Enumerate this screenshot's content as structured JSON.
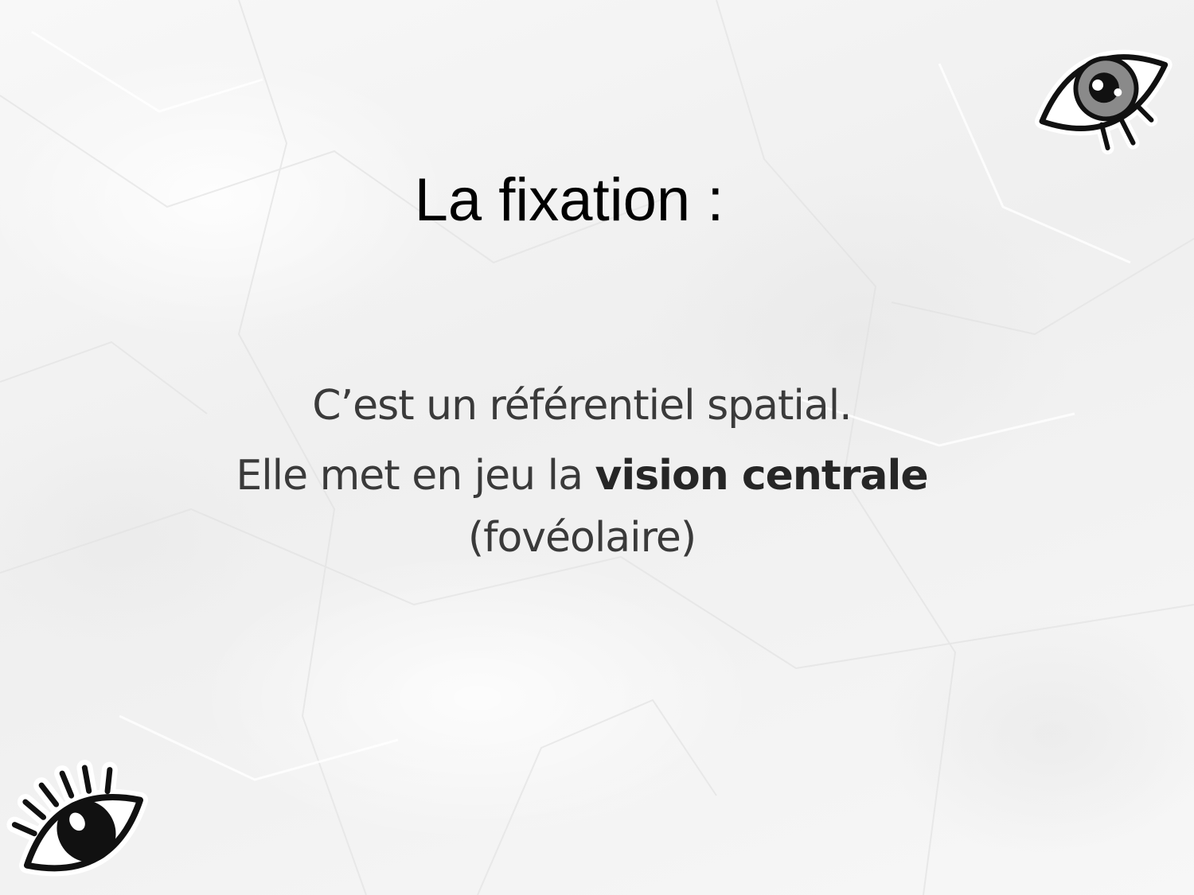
{
  "slide": {
    "title": "La fixation :",
    "line1": "C’est un référentiel spatial.",
    "line2_prefix": "Elle met en jeu la ",
    "line2_emphasis": "vision centrale",
    "line3": "(fovéolaire)"
  },
  "decorations": {
    "top_right_icon": "eye-sticker-icon",
    "bottom_left_icon": "eyelash-eye-sticker-icon"
  },
  "colors": {
    "title": "#000000",
    "body": "#3a3a3a",
    "iris_grey": "#8a8a8a",
    "background": "#f6f6f6"
  }
}
